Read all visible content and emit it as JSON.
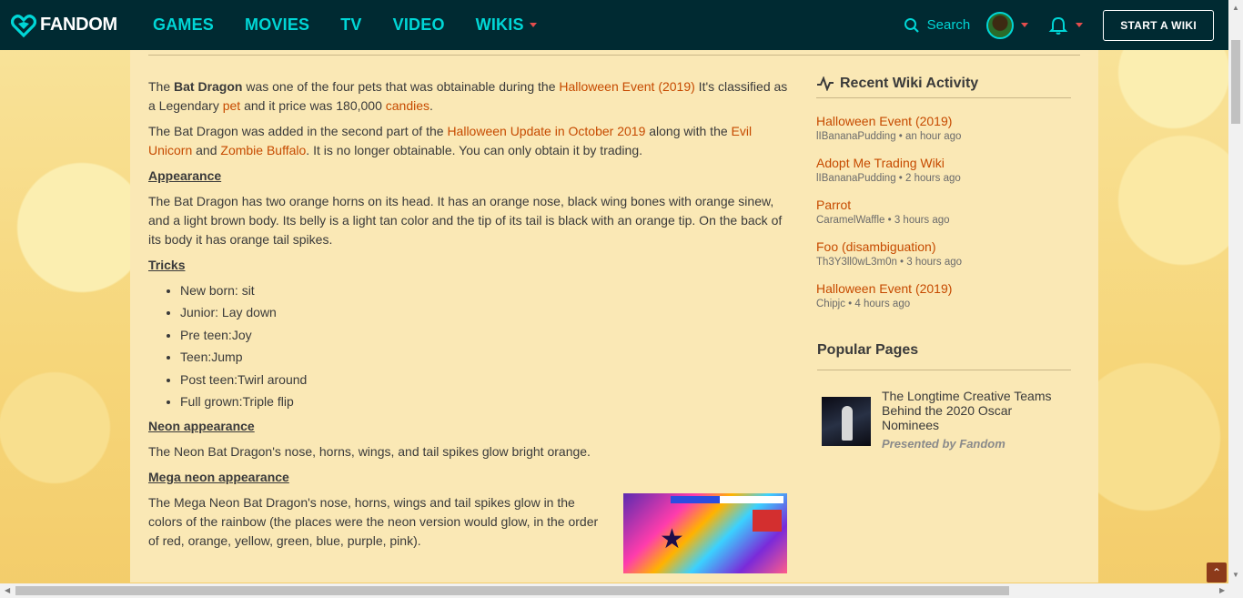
{
  "nav": {
    "logo_text": "FANDOM",
    "links": [
      "GAMES",
      "MOVIES",
      "TV",
      "VIDEO",
      "WIKIS"
    ],
    "search_label": "Search",
    "start_wiki": "START A WIKI"
  },
  "article": {
    "intro": {
      "p1_a": "The ",
      "p1_bold": "Bat Dragon",
      "p1_b": " was one of the four pets that was obtainable during the ",
      "p1_link1": "Halloween Event (2019)",
      "p1_c": " It's classified as a Legendary ",
      "p1_link2": "pet",
      "p1_d": " and it price was 180,000 ",
      "p1_link3": "candies",
      "p1_e": ".",
      "p2_a": "The Bat Dragon was added in the second part of the ",
      "p2_link1": "Halloween Update in October 2019",
      "p2_b": " along with the ",
      "p2_link2": "Evil Unicorn",
      "p2_c": " and ",
      "p2_link3": "Zombie Buffalo",
      "p2_d": ". It is no longer obtainable. You can only obtain it by trading."
    },
    "appearance_heading": "Appearance",
    "appearance_text": "The Bat Dragon has two orange horns on its head. It has an orange nose, black wing bones with orange sinew, and a light brown body. Its belly is a light tan color and the tip of its tail is black with an orange tip. On the back of its body it has orange tail spikes.",
    "tricks_heading": "Tricks",
    "tricks": [
      "New born: sit",
      "Junior: Lay down",
      "Pre teen:Joy",
      "Teen:Jump",
      "Post teen:Twirl around",
      "Full grown:Triple flip"
    ],
    "neon_heading": "Neon appearance",
    "neon_text": "The Neon Bat Dragon's nose, horns, wings, and tail spikes glow bright orange.",
    "mega_heading": "Mega neon appearance",
    "mega_text": "The Mega Neon Bat Dragon's nose, horns, wings and tail spikes glow in the colors of the rainbow (the places were the neon version would glow, in the order of red, orange, yellow, green, blue, purple, pink)."
  },
  "rail": {
    "activity_heading": "Recent Wiki Activity",
    "activity": [
      {
        "title": "Halloween Event (2019)",
        "meta": "lIBananaPudding • an hour ago"
      },
      {
        "title": "Adopt Me Trading Wiki",
        "meta": "lIBananaPudding • 2 hours ago"
      },
      {
        "title": "Parrot",
        "meta": "CaramelWaffle • 3 hours ago"
      },
      {
        "title": "Foo (disambiguation)",
        "meta": "Th3Y3ll0wL3m0n • 3 hours ago"
      },
      {
        "title": "Halloween Event (2019)",
        "meta": "Chipjc • 4 hours ago"
      }
    ],
    "popular_heading": "Popular Pages",
    "popular": {
      "title": "The Longtime Creative Teams Behind the 2020 Oscar Nominees",
      "sub": "Presented by Fandom"
    }
  },
  "colors": {
    "nav_bg": "#002a32",
    "nav_accent": "#00d6d6",
    "link": "#c64a00",
    "link_red": "#d32f2f"
  }
}
